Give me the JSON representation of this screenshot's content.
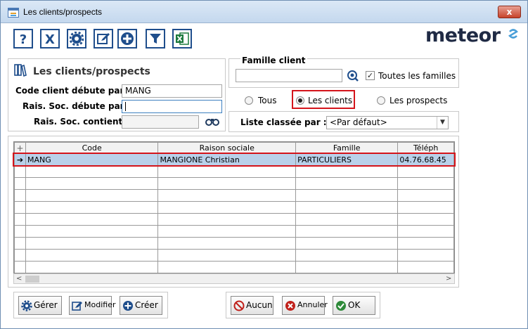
{
  "window": {
    "title": "Les clients/prospects",
    "close_label": "x"
  },
  "toolbar": {
    "help_label": "?",
    "export_label": "X",
    "settings_label": "",
    "edit_label": "",
    "add_label": "",
    "filter_label": "",
    "excel_label": ""
  },
  "logo": {
    "text": "meteor"
  },
  "search_panel": {
    "title": "Les clients/prospects",
    "code_label": "Code client débute par :",
    "code_value": "MANG",
    "rais_starts_label": "Rais. Soc. débute par :",
    "rais_starts_value": "",
    "rais_contains_label": "Rais. Soc. contient :",
    "rais_contains_value": ""
  },
  "famille": {
    "title": "Famille client",
    "value": "",
    "toutes_label": "Toutes les familles",
    "toutes_checked": true
  },
  "type_filter": {
    "tous_label": "Tous",
    "clients_label": "Les clients",
    "prospects_label": "Les prospects",
    "selected": "clients"
  },
  "sort": {
    "label": "Liste classée par :",
    "selected": "<Par défaut>"
  },
  "grid": {
    "columns": [
      "Code",
      "Raison sociale",
      "Famille",
      "Téléph"
    ],
    "rows": [
      {
        "code": "MANG",
        "raison": "MANGIONE Christian",
        "famille": "PARTICULIERS",
        "tel": "04.76.68.45"
      }
    ],
    "empty_rows": 9
  },
  "buttons": {
    "gerer": "Gérer",
    "modifier": "Modifier",
    "creer": "Créer",
    "aucun": "Aucun",
    "annuler": "Annuler",
    "ok": "OK"
  },
  "colors": {
    "toolbar_border": "#1f4e8c",
    "highlight_red": "#d4141b",
    "selected_row": "#b9d1ea"
  }
}
